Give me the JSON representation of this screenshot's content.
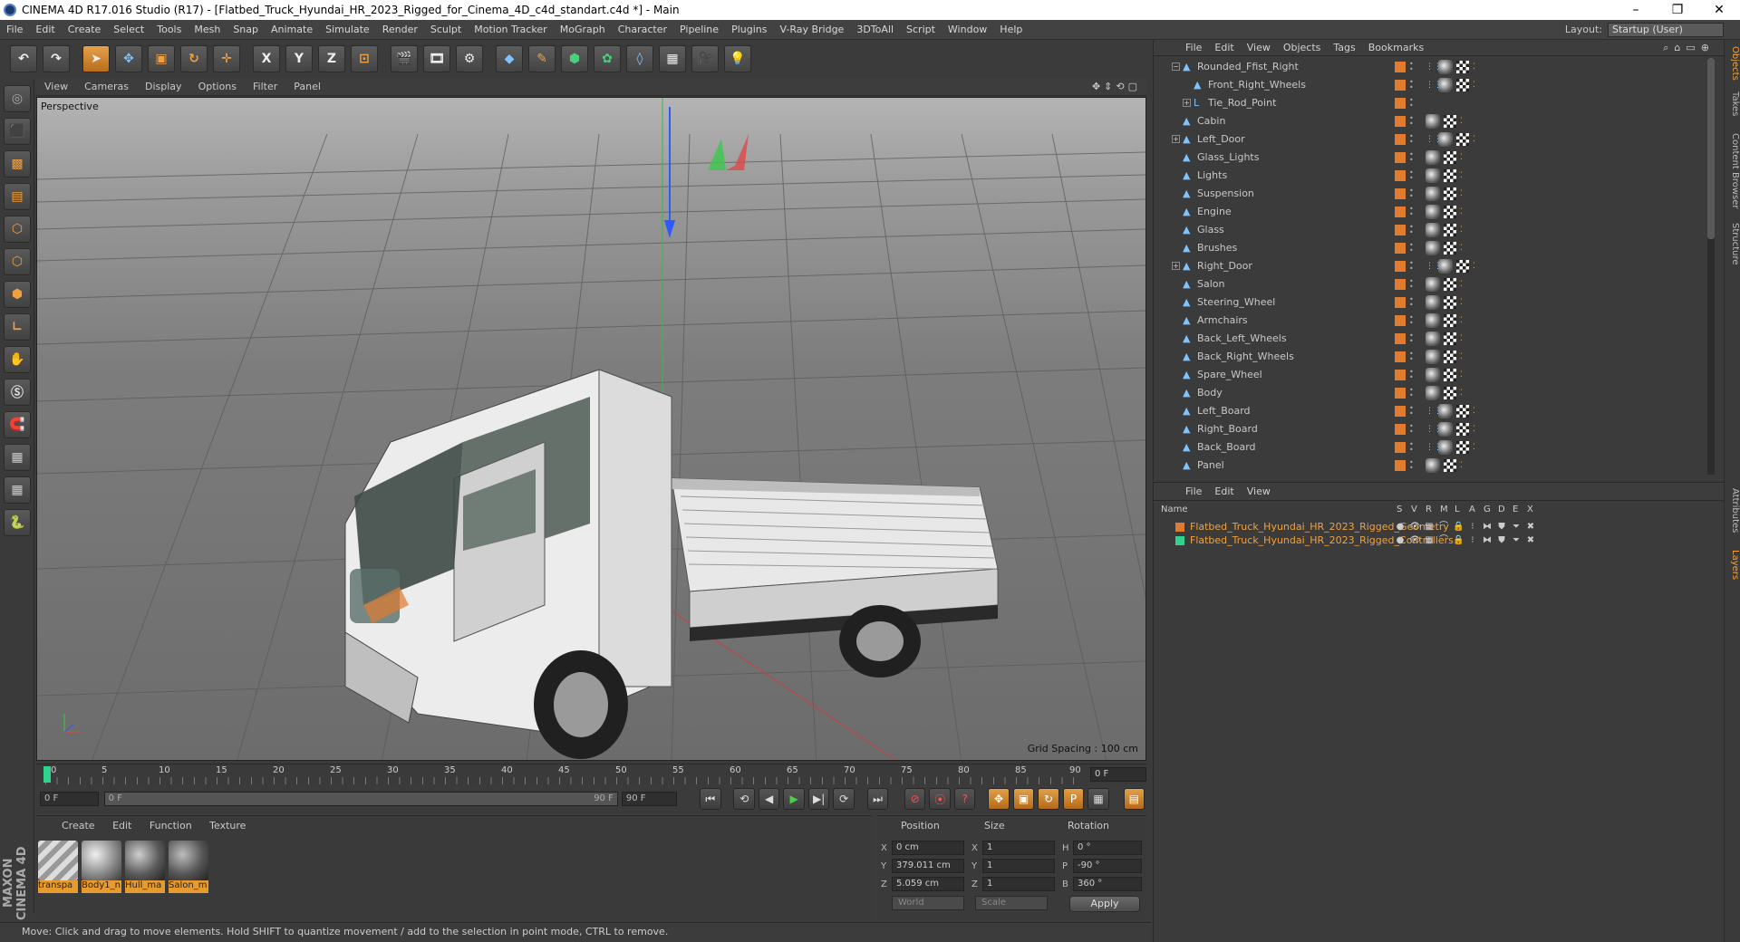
{
  "window": {
    "title": "CINEMA 4D R17.016 Studio (R17) - [Flatbed_Truck_Hyundai_HR_2023_Rigged_for_Cinema_4D_c4d_standart.c4d *] - Main",
    "minimize": "–",
    "maximize": "❐",
    "close": "✕"
  },
  "menubar": {
    "items": [
      "File",
      "Edit",
      "Create",
      "Select",
      "Tools",
      "Mesh",
      "Snap",
      "Animate",
      "Simulate",
      "Render",
      "Sculpt",
      "Motion Tracker",
      "MoGraph",
      "Character",
      "Pipeline",
      "Plugins",
      "V-Ray Bridge",
      "3DToAll",
      "Script",
      "Window",
      "Help"
    ],
    "layout_label": "Layout:",
    "layout_value": "Startup (User)"
  },
  "toolbar": {
    "undo": "↶",
    "redo": "↷",
    "x": "X",
    "y": "Y",
    "z": "Z"
  },
  "viewport_menu": [
    "View",
    "Cameras",
    "Display",
    "Options",
    "Filter",
    "Panel"
  ],
  "viewport": {
    "label": "Perspective",
    "grid_spacing": "Grid Spacing : 100 cm"
  },
  "timeline": {
    "ticks": [
      "0",
      "5",
      "10",
      "15",
      "20",
      "25",
      "30",
      "35",
      "40",
      "45",
      "50",
      "55",
      "60",
      "65",
      "70",
      "75",
      "80",
      "85",
      "90"
    ],
    "current_frame": "0 F"
  },
  "playbar": {
    "start": "0 F",
    "range_start": "0 F",
    "range_end": "90 F",
    "end": "90 F"
  },
  "materials": {
    "menu": [
      "Create",
      "Edit",
      "Function",
      "Texture"
    ],
    "items": [
      "transpa",
      "Body1_n",
      "Hull_ma",
      "Salon_m"
    ]
  },
  "coords": {
    "headers": [
      "Position",
      "Size",
      "Rotation"
    ],
    "rows": [
      {
        "axis": "X",
        "pos": "0 cm",
        "size_axis": "X",
        "size": "1",
        "rot_axis": "H",
        "rot": "0 °"
      },
      {
        "axis": "Y",
        "pos": "379.011 cm",
        "size_axis": "Y",
        "size": "1",
        "rot_axis": "P",
        "rot": "-90 °"
      },
      {
        "axis": "Z",
        "pos": "5.059 cm",
        "size_axis": "Z",
        "size": "1",
        "rot_axis": "B",
        "rot": "360 °"
      }
    ],
    "world": "World",
    "scale": "Scale",
    "apply": "Apply"
  },
  "status": "Move: Click and drag to move elements. Hold SHIFT to quantize movement / add to the selection in point mode, CTRL to remove.",
  "maxon": "MAXON CINEMA 4D",
  "object_manager": {
    "menu": [
      "File",
      "Edit",
      "View",
      "Objects",
      "Tags",
      "Bookmarks"
    ],
    "objects": [
      {
        "name": "Rounded_Ffist_Right",
        "indent": 1,
        "expander": "−",
        "tags": 3
      },
      {
        "name": "Front_Right_Wheels",
        "indent": 2,
        "expander": "",
        "tags": 3
      },
      {
        "name": "Tie_Rod_Point",
        "indent": 2,
        "expander": "+",
        "tags": 0
      },
      {
        "name": "Cabin",
        "indent": 1,
        "expander": "",
        "tags": 2
      },
      {
        "name": "Left_Door",
        "indent": 1,
        "expander": "+",
        "tags": 3
      },
      {
        "name": "Glass_Lights",
        "indent": 1,
        "expander": "",
        "tags": 2
      },
      {
        "name": "Lights",
        "indent": 1,
        "expander": "",
        "tags": 2
      },
      {
        "name": "Suspension",
        "indent": 1,
        "expander": "",
        "tags": 2
      },
      {
        "name": "Engine",
        "indent": 1,
        "expander": "",
        "tags": 2
      },
      {
        "name": "Glass",
        "indent": 1,
        "expander": "",
        "tags": 2
      },
      {
        "name": "Brushes",
        "indent": 1,
        "expander": "",
        "tags": 2
      },
      {
        "name": "Right_Door",
        "indent": 1,
        "expander": "+",
        "tags": 3
      },
      {
        "name": "Salon",
        "indent": 1,
        "expander": "",
        "tags": 2
      },
      {
        "name": "Steering_Wheel",
        "indent": 1,
        "expander": "",
        "tags": 2
      },
      {
        "name": "Armchairs",
        "indent": 1,
        "expander": "",
        "tags": 2
      },
      {
        "name": "Back_Left_Wheels",
        "indent": 1,
        "expander": "",
        "tags": 2
      },
      {
        "name": "Back_Right_Wheels",
        "indent": 1,
        "expander": "",
        "tags": 2
      },
      {
        "name": "Spare_Wheel",
        "indent": 1,
        "expander": "",
        "tags": 2
      },
      {
        "name": "Body",
        "indent": 1,
        "expander": "",
        "tags": 2
      },
      {
        "name": "Left_Board",
        "indent": 1,
        "expander": "",
        "tags": 3
      },
      {
        "name": "Right_Board",
        "indent": 1,
        "expander": "",
        "tags": 3
      },
      {
        "name": "Back_Board",
        "indent": 1,
        "expander": "",
        "tags": 3
      },
      {
        "name": "Panel",
        "indent": 1,
        "expander": "",
        "tags": 2
      }
    ]
  },
  "layer_manager": {
    "menu": [
      "File",
      "Edit",
      "View"
    ],
    "header_name": "Name",
    "header_cols": [
      "S",
      "V",
      "R",
      "M",
      "L",
      "A",
      "G",
      "D",
      "E",
      "X"
    ],
    "layers": [
      {
        "name": "Flatbed_Truck_Hyundai_HR_2023_Rigged_Geometry",
        "color": "#e07b30"
      },
      {
        "name": "Flatbed_Truck_Hyundai_HR_2023_Rigged_Controllers",
        "color": "#2fd38b"
      }
    ]
  },
  "side_tabs": [
    "Objects",
    "Takes",
    "Content Browser",
    "Structure",
    "Attributes",
    "Layers"
  ]
}
